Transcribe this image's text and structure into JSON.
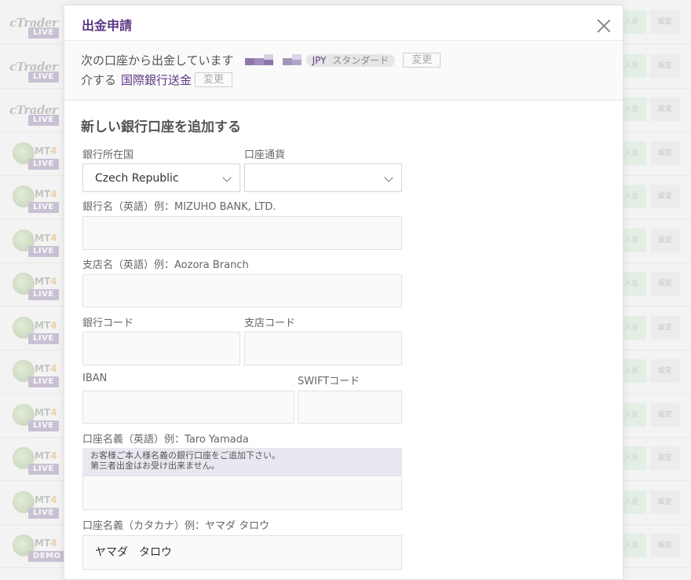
{
  "background": {
    "rows": [
      {
        "platform": "cTrader",
        "tag": "LIVE",
        "deposit": "入金",
        "settings": "設定"
      },
      {
        "platform": "cTrader",
        "tag": "LIVE",
        "deposit": "入金",
        "settings": "設定"
      },
      {
        "platform": "cTrader",
        "tag": "LIVE",
        "deposit": "入金",
        "settings": "設定"
      },
      {
        "platform": "MT4",
        "tag": "LIVE",
        "deposit": "入金",
        "settings": "設定"
      },
      {
        "platform": "MT4",
        "tag": "LIVE",
        "deposit": "入金",
        "settings": "設定"
      },
      {
        "platform": "MT4",
        "tag": "LIVE",
        "deposit": "入金",
        "settings": "設定"
      },
      {
        "platform": "MT4",
        "tag": "LIVE",
        "deposit": "入金",
        "settings": "設定"
      },
      {
        "platform": "MT4",
        "tag": "LIVE",
        "deposit": "入金",
        "settings": "設定"
      },
      {
        "platform": "MT4",
        "tag": "LIVE",
        "deposit": "入金",
        "settings": "設定"
      },
      {
        "platform": "MT4",
        "tag": "LIVE",
        "deposit": "入金",
        "settings": "設定"
      },
      {
        "platform": "MT4",
        "tag": "LIVE",
        "deposit": "入金",
        "settings": "設定"
      },
      {
        "platform": "MT4",
        "tag": "LIVE",
        "deposit": "入金",
        "settings": "設定"
      },
      {
        "platform": "MT4",
        "tag": "DEMO",
        "deposit": "入金",
        "settings": "設定"
      }
    ]
  },
  "modal": {
    "title": "出金申請",
    "from_text": "次の口座から出金しています",
    "account_currency": "JPY",
    "account_type": "スタンダード",
    "change_label": "変更",
    "via_text": "介する",
    "method": "国際銀行送金",
    "method_change_label": "変更",
    "form_heading": "新しい銀行口座を追加する",
    "country_label": "銀行所在国",
    "country_value": "Czech Republic",
    "currency_label": "口座通貨",
    "currency_value": "",
    "bank_name_label": "銀行名（英語）例：MIZUHO BANK, LTD.",
    "bank_name_value": "",
    "branch_name_label": "支店名（英語）例：Aozora Branch",
    "branch_name_value": "",
    "bank_code_label": "銀行コード",
    "branch_code_label": "支店コード",
    "iban_label": "IBAN",
    "swift_label": "SWIFTコード",
    "holder_en_label": "口座名義（英語）例：Taro Yamada",
    "holder_notice_line1": "お客様ご本人様名義の銀行口座をご追加下さい。",
    "holder_notice_line2": "第三者出金はお受け出来ません。",
    "holder_kana_label": "口座名義（カタカナ）例：ヤマダ タロウ",
    "holder_kana_value": "ヤマダ　タロウ"
  },
  "colors": {
    "brand": "#5e3a86",
    "notice_bg": "#ebe7f0"
  }
}
